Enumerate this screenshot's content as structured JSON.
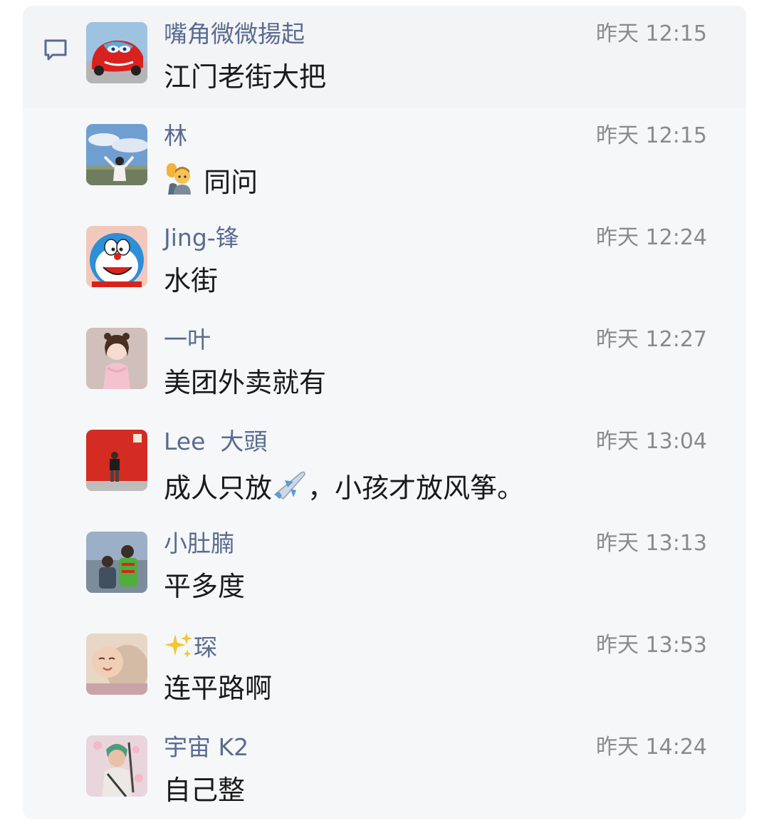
{
  "comments": [
    {
      "name": "嘴角微微揚起",
      "time": "昨天 12:15",
      "message": "江门老街大把",
      "avatar": "red-car-avatar"
    },
    {
      "name": "林",
      "time": "昨天 12:15",
      "message_emoji": "person-raising-hand-emoji",
      "message": "同问",
      "avatar": "sky-girl-avatar"
    },
    {
      "name": "Jing-锋",
      "time": "昨天 12:24",
      "message": "水街",
      "avatar": "doraemon-avatar"
    },
    {
      "name": "一叶",
      "time": "昨天 12:27",
      "message": "美团外卖就有",
      "avatar": "girl-pink-avatar"
    },
    {
      "name": "Lee  大頭",
      "time": "昨天 13:04",
      "message_before": "成人只放",
      "message_emoji": "airplane-emoji",
      "message_after": "，小孩才放风筝。",
      "avatar": "red-wall-man-avatar"
    },
    {
      "name": "小肚腩",
      "time": "昨天 13:13",
      "message": "平多度",
      "avatar": "two-kids-avatar"
    },
    {
      "name_emoji": "sparkles-emoji",
      "name": "琛",
      "time": "昨天 13:53",
      "message": "连平路啊",
      "avatar": "baby-avatar"
    },
    {
      "name": "宇宙 K2",
      "time": "昨天 14:24",
      "message": "自己整",
      "avatar": "anime-swordsman-avatar"
    }
  ],
  "colors": {
    "card_bg": "#f6f7f9",
    "name": "#596b91",
    "time": "#8a8a8a",
    "message": "#1a1a1a"
  }
}
